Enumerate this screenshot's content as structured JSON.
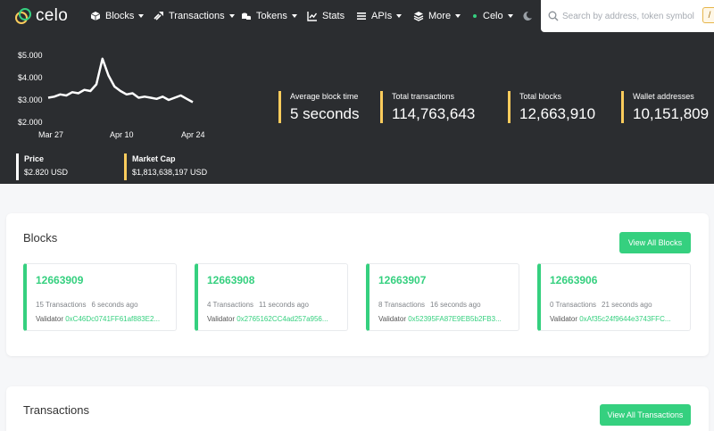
{
  "brand": {
    "name": "celo"
  },
  "nav": {
    "items": [
      {
        "label": "Blocks",
        "icon": "cube-icon"
      },
      {
        "label": "Transactions",
        "icon": "arrows-icon"
      },
      {
        "label": "Tokens",
        "icon": "coins-icon"
      },
      {
        "label": "Stats",
        "icon": "stats-icon"
      },
      {
        "label": "APIs",
        "icon": "list-icon"
      },
      {
        "label": "More",
        "icon": "layers-icon"
      }
    ],
    "network": "Celo",
    "network_dot_color": "#35d07f",
    "theme_icon": "moon-icon"
  },
  "search": {
    "placeholder": "Search by address, token symbol, n",
    "shortcut": "/"
  },
  "chart_data": {
    "type": "line",
    "title": "",
    "x_ticks": [
      "Mar 27",
      "Apr 10",
      "Apr 24"
    ],
    "y_ticks": [
      "$5.000",
      "$4.000",
      "$3.000",
      "$2.000"
    ],
    "ylim": [
      2,
      5
    ],
    "series": [
      {
        "values": [
          3.1,
          3.15,
          3.25,
          3.2,
          3.35,
          3.3,
          3.45,
          3.4,
          3.7,
          4.85,
          4.1,
          3.6,
          3.4,
          3.25,
          3.3,
          3.1,
          3.15,
          3.1,
          3.05,
          3.15,
          3.0,
          3.1,
          3.2,
          3.05,
          2.9
        ],
        "color": "#ffffff"
      }
    ],
    "grid": false
  },
  "price": {
    "label": "Price",
    "value": "$2.820 USD"
  },
  "market_cap": {
    "label": "Market Cap",
    "value": "$1,813,638,197 USD"
  },
  "stats": [
    {
      "label": "Average block time",
      "value": "5 seconds"
    },
    {
      "label": "Total transactions",
      "value": "114,763,643"
    },
    {
      "label": "Total blocks",
      "value": "12,663,910"
    },
    {
      "label": "Wallet addresses",
      "value": "10,151,809"
    }
  ],
  "blocks_card": {
    "title": "Blocks",
    "button": "View All Blocks",
    "validator_label": "Validator",
    "blocks": [
      {
        "number": "12663909",
        "transactions": "15 Transactions",
        "age": "6 seconds ago",
        "validator": "0xC46Dc0741FF61af883E2..."
      },
      {
        "number": "12663908",
        "transactions": "4 Transactions",
        "age": "11 seconds ago",
        "validator": "0x2765162CC4ad257a956..."
      },
      {
        "number": "12663907",
        "transactions": "8 Transactions",
        "age": "16 seconds ago",
        "validator": "0x52395FA87E9EB5b2FB3..."
      },
      {
        "number": "12663906",
        "transactions": "0 Transactions",
        "age": "21 seconds ago",
        "validator": "0xAf35c24f9644e3743FFC..."
      }
    ]
  },
  "transactions_card": {
    "title": "Transactions",
    "button": "View All Transactions"
  },
  "colors": {
    "header_bg": "#2b2d30",
    "accent_green": "#35d07f",
    "accent_yellow": "#fbcc5c"
  }
}
